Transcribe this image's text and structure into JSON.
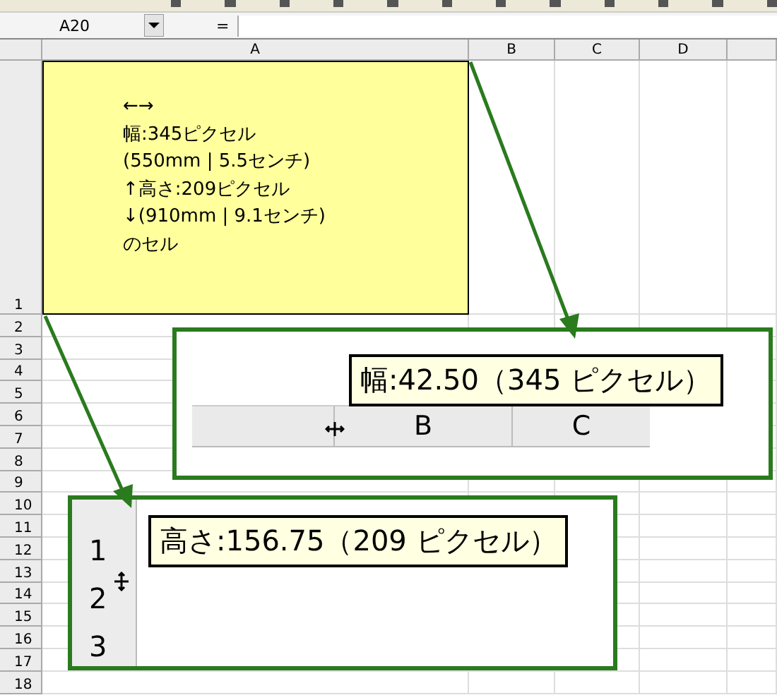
{
  "formula_bar": {
    "name_box": "A20",
    "equals": "="
  },
  "columns": [
    "A",
    "B",
    "C",
    "D"
  ],
  "rows": [
    "1",
    "2",
    "3",
    "4",
    "5",
    "6",
    "7",
    "8",
    "9",
    "10",
    "11",
    "12",
    "13",
    "14",
    "15",
    "16",
    "17",
    "18"
  ],
  "note": {
    "lines": [
      "←→",
      "幅:345ピクセル",
      "(550mm | 5.5センチ)",
      "↑高さ:209ピクセル",
      "↓(910mm | 9.1センチ)",
      "のセル"
    ]
  },
  "width_callout": {
    "tooltip": "幅:42.50（345 ピクセル）",
    "headers": [
      "B",
      "C"
    ]
  },
  "height_callout": {
    "tooltip": "高さ:156.75（209 ピクセル）",
    "row_headers": [
      "1",
      "2",
      "3"
    ]
  }
}
